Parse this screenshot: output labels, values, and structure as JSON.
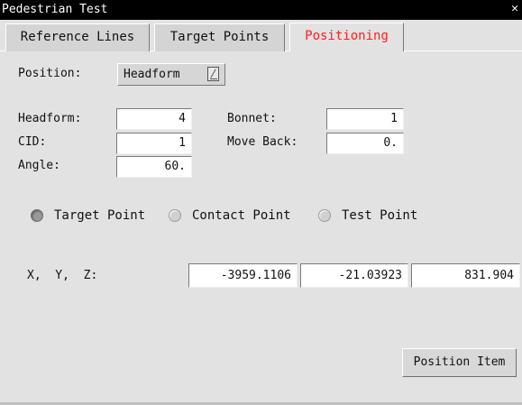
{
  "window": {
    "title": "Pedestrian Test",
    "close_glyph": "✕"
  },
  "tabs": [
    {
      "label": "Reference Lines",
      "active": false
    },
    {
      "label": "Target Points",
      "active": false
    },
    {
      "label": "Positioning",
      "active": true
    }
  ],
  "accent_color": "#ff1f1f",
  "position": {
    "label": "Position:",
    "value": "Headform",
    "icon": "dropdown-arrow-icon"
  },
  "fields": {
    "headform": {
      "label": "Headform:",
      "value": "4"
    },
    "bonnet": {
      "label": "Bonnet:",
      "value": "1"
    },
    "cid": {
      "label": "CID:",
      "value": "1"
    },
    "move_back": {
      "label": "Move Back:",
      "value": "0."
    },
    "angle": {
      "label": "Angle:",
      "value": "60."
    }
  },
  "radios": [
    {
      "label": "Target Point",
      "checked": true
    },
    {
      "label": "Contact Point",
      "checked": false
    },
    {
      "label": "Test Point",
      "checked": false
    }
  ],
  "xyz": {
    "label": "X,  Y,  Z:",
    "x": "-3959.1106",
    "y": "-21.03923",
    "z": "831.904"
  },
  "actions": {
    "position_item": "Position Item"
  }
}
